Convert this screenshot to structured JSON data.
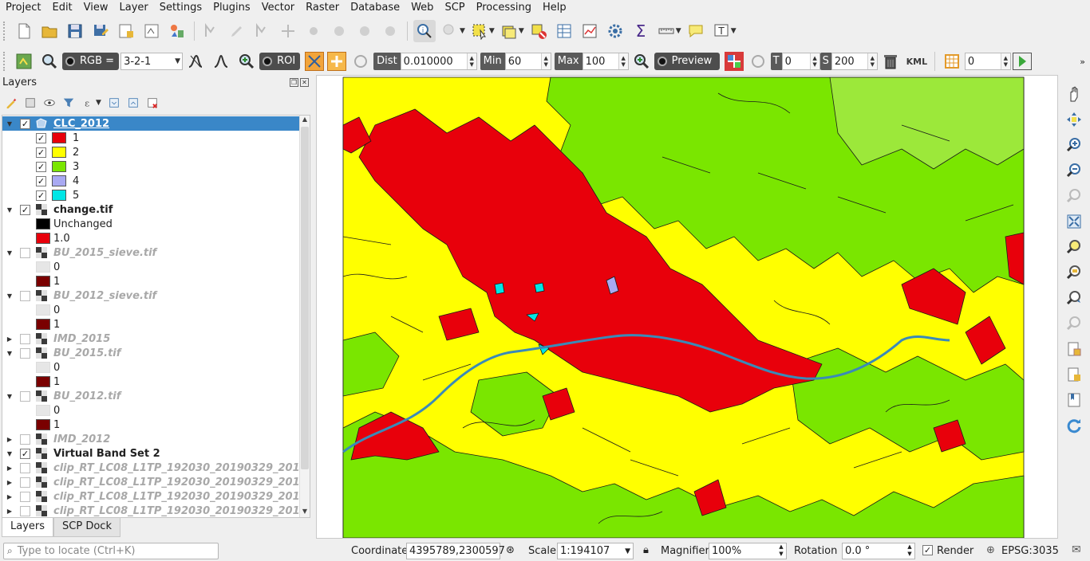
{
  "menu": [
    "Project",
    "Edit",
    "View",
    "Layer",
    "Settings",
    "Plugins",
    "Vector",
    "Raster",
    "Database",
    "Web",
    "SCP",
    "Processing",
    "Help"
  ],
  "scp_toolbar": {
    "rgb_label": "RGB =",
    "rgb_value": "3-2-1",
    "roi_label": "ROI",
    "dist_label": "Dist",
    "dist_value": "0.010000",
    "min_label": "Min",
    "min_value": "60",
    "max_label": "Max",
    "max_value": "100",
    "preview_label": "Preview",
    "t_label": "T",
    "t_value": "0",
    "s_label": "S",
    "s_value": "200",
    "kml_label": "KML",
    "band_value": "0"
  },
  "layers_panel": {
    "title": "Layers",
    "items": [
      {
        "name": "CLC_2012",
        "style": "selected"
      },
      {
        "name": "1",
        "color": "#e8000b"
      },
      {
        "name": "2",
        "color": "#ffff00"
      },
      {
        "name": "3",
        "color": "#7ae600"
      },
      {
        "name": "4",
        "color": "#a9a9f2"
      },
      {
        "name": "5",
        "color": "#00e6e6"
      },
      {
        "name": "change.tif",
        "style": "bold"
      },
      {
        "name": "Unchanged",
        "color": "#000000"
      },
      {
        "name": "1.0",
        "color": "#e8000b"
      },
      {
        "name": "BU_2015_sieve.tif",
        "style": "greyed"
      },
      {
        "name": "0",
        "color": "#e6e6e6"
      },
      {
        "name": "1",
        "color": "#7a0000"
      },
      {
        "name": "BU_2012_sieve.tif",
        "style": "greyed"
      },
      {
        "name": "0",
        "color": "#e6e6e6"
      },
      {
        "name": "1",
        "color": "#7a0000"
      },
      {
        "name": "IMD_2015",
        "style": "greyed"
      },
      {
        "name": "BU_2015.tif",
        "style": "greyed"
      },
      {
        "name": "0",
        "color": "#e6e6e6"
      },
      {
        "name": "1",
        "color": "#7a0000"
      },
      {
        "name": "BU_2012.tif",
        "style": "greyed"
      },
      {
        "name": "0",
        "color": "#e6e6e6"
      },
      {
        "name": "1",
        "color": "#7a0000"
      },
      {
        "name": "IMD_2012",
        "style": "greyed"
      },
      {
        "name": "Virtual Band Set 2",
        "style": "bold"
      },
      {
        "name": "clip_RT_LC08_L1TP_192030_20190329_201...",
        "style": "greyed"
      },
      {
        "name": "clip_RT_LC08_L1TP_192030_20190329_201...",
        "style": "greyed"
      },
      {
        "name": "clip_RT_LC08_L1TP_192030_20190329_201...",
        "style": "greyed"
      },
      {
        "name": "clip_RT_LC08_L1TP_192030_20190329_201...",
        "style": "greyed"
      }
    ],
    "tabs": [
      "Layers",
      "SCP Dock"
    ]
  },
  "statusbar": {
    "locate_placeholder": "Type to locate (Ctrl+K)",
    "coordinate_label": "Coordinate",
    "coordinate_value": "4395789,2300597",
    "scale_label": "Scale",
    "scale_value": "1:194107",
    "magnifier_label": "Magnifier",
    "magnifier_value": "100%",
    "rotation_label": "Rotation",
    "rotation_value": "0.0 °",
    "render_label": "Render",
    "crs_label": "EPSG:3035"
  },
  "colors": {
    "urban": "#e8000b",
    "agri": "#ffff00",
    "forest": "#7ae600",
    "wetland": "#a9a9f2",
    "water": "#00e6e6",
    "selection": "#3a87c8"
  }
}
